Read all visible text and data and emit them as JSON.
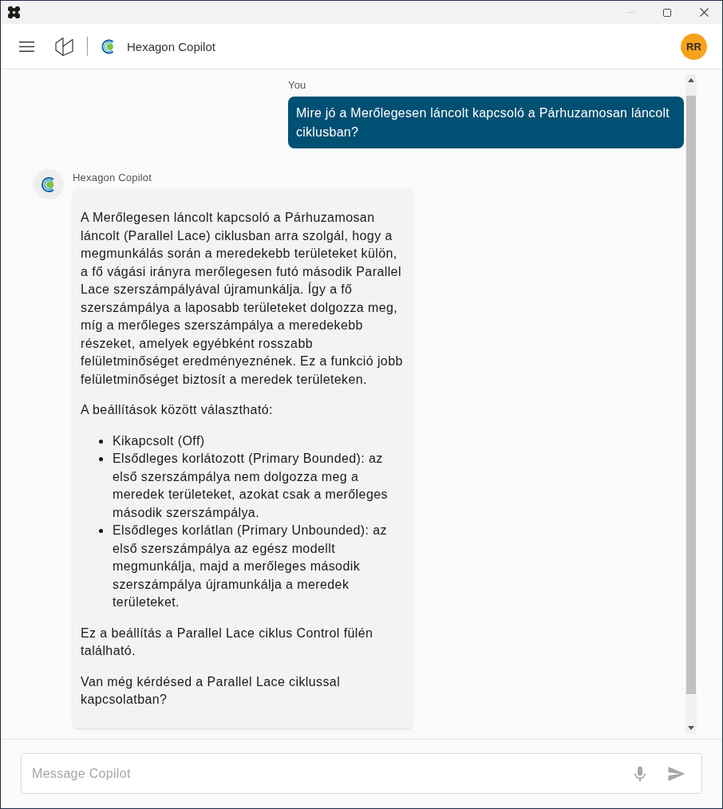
{
  "window": {
    "controls": [
      {
        "kind": "minimize",
        "disabled": true
      },
      {
        "kind": "maximize",
        "disabled": false
      },
      {
        "kind": "close",
        "disabled": false
      }
    ]
  },
  "header": {
    "app_name": "Hexagon Copilot",
    "avatar_initials": "RR"
  },
  "conversation": [
    {
      "kind": "user",
      "sender": "You",
      "text": "Mire jó a Merőlegesen láncolt kapcsoló a Párhuzamosan láncolt ciklusban?"
    },
    {
      "kind": "assistant",
      "sender": "Hexagon Copilot",
      "blocks": [
        {
          "kind": "paragraph",
          "text": "A Merőlegesen láncolt kapcsoló a Párhuzamosan láncolt (Parallel Lace) ciklusban arra szolgál, hogy a megmunkálás során a meredekebb területeket külön, a fő vágási irányra merőlegesen futó második Parallel Lace szerszámpályával újramunkálja. Így a fő szerszámpálya a laposabb területeket dolgozza meg, míg a merőleges szerszámpálya a meredekebb részeket, amelyek egyébként rosszabb felületminőséget eredményeznének. Ez a funkció jobb felületminőséget biztosít a meredek területeken."
        },
        {
          "kind": "paragraph",
          "text": "A beállítások között választható:"
        },
        {
          "kind": "list",
          "items": [
            "Kikapcsolt (Off)",
            "Elsődleges korlátozott (Primary Bounded): az első szerszámpálya nem dolgozza meg a meredek területeket, azokat csak a merőleges második szerszámpálya.",
            "Elsődleges korlátlan (Primary Unbounded): az első szerszámpálya az egész modellt megmunkálja, majd a merőleges második szerszámpálya újramunkálja a meredek területeket."
          ]
        },
        {
          "kind": "paragraph",
          "text": "Ez a beállítás a Parallel Lace ciklus Control fülén található."
        },
        {
          "kind": "paragraph",
          "text": "Van még kérdésed a Parallel Lace ciklussal kapcsolatban?"
        }
      ]
    }
  ],
  "composer": {
    "placeholder": "Message Copilot"
  }
}
